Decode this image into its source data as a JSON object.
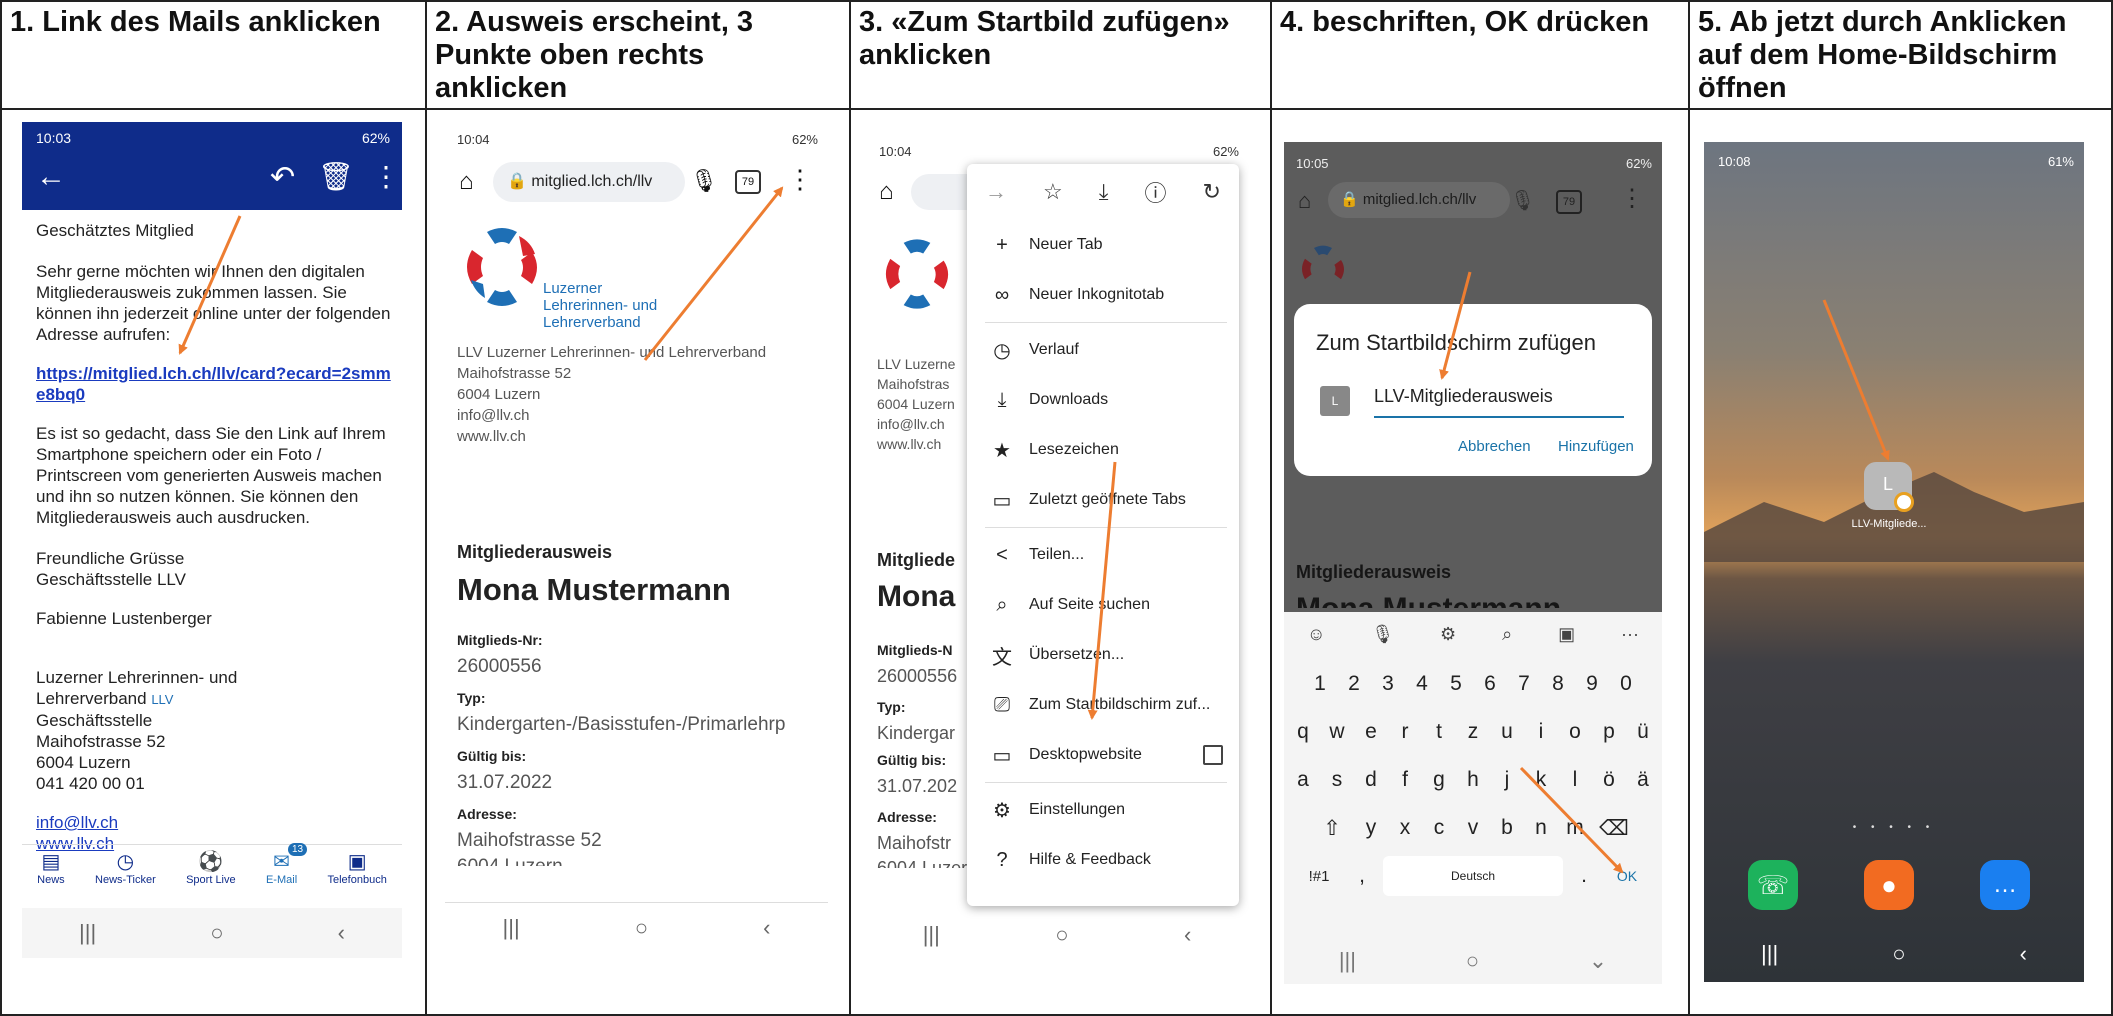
{
  "columns": [
    {
      "heading": "1. Link des Mails anklicken"
    },
    {
      "heading": "2. Ausweis erscheint, 3 Punkte oben rechts anklicken"
    },
    {
      "heading": "3. «Zum Startbild zufügen» anklicken"
    },
    {
      "heading": "4. beschriften, OK drücken"
    },
    {
      "heading": "5. Ab jetzt durch Anklicken auf dem Home-Bildschirm öffnen"
    }
  ],
  "screen1": {
    "time": "10:03",
    "status": "62%",
    "greeting": "Geschätztes Mitglied",
    "para1": "Sehr gerne möchten wir Ihnen den digitalen Mitgliederausweis zukommen lassen. Sie können ihn jederzeit online unter der folgenden Adresse aufrufen:",
    "link": "https://mitglied.lch.ch/llv/card?ecard=2smme8bq0",
    "para2": "Es ist so gedacht, dass Sie den Link auf Ihrem Smartphone speichern oder ein Foto / Printscreen vom generierten Ausweis machen und ihn so nutzen können. Sie können den Mitgliederausweis auch ausdrucken.",
    "closing1": "Freundliche Grüsse",
    "closing2": "Geschäftsstelle LLV",
    "signer": "Fabienne Lustenberger",
    "org1": "Luzerner Lehrerinnen- und",
    "org2": "Lehrerverband",
    "org2_badge": "LLV",
    "org3": "Geschäftsstelle",
    "org4": "Maihofstrasse 52",
    "org5": "6004 Luzern",
    "org6": "041 420 00 01",
    "mail": "info@llv.ch",
    "web": "www.llv.ch",
    "tabs": [
      "News",
      "News-Ticker",
      "Sport Live",
      "E-Mail",
      "Telefonbuch"
    ],
    "mail_badge": "13"
  },
  "screen2": {
    "time": "10:04",
    "status": "62%",
    "url": "mitglied.lch.ch/llv",
    "tab_count": "79",
    "logo1": "Luzerner",
    "logo2": "Lehrerinnen- und",
    "logo3": "Lehrerverband",
    "addr1": "LLV Luzerner Lehrerinnen- und Lehrerverband",
    "addr2": "Maihofstrasse 52",
    "addr3": "6004 Luzern",
    "addr4": "info@llv.ch",
    "addr5": "www.llv.ch",
    "card_title": "Mitgliederausweis",
    "name": "Mona Mustermann",
    "lbl_nr": "Mitglieds-Nr:",
    "nr": "26000556",
    "lbl_typ": "Typ:",
    "typ": "Kindergarten-/Basisstufen-/Primarlehrp",
    "lbl_valid": "Gültig bis:",
    "valid": "31.07.2022",
    "lbl_addr": "Adresse:",
    "addr": "Maihofstrasse 52",
    "addr_cut": "6004 Luzern"
  },
  "screen3": {
    "time": "10:04",
    "status": "62%",
    "bg_lines": [
      "LLV Luzerne",
      "Maihofstras",
      "6004 Luzern",
      "info@llv.ch",
      "www.llv.ch"
    ],
    "bg_title": "Mitgliede",
    "bg_name": "Mona",
    "bg_lbl_nr": "Mitglieds-N",
    "bg_nr": "26000556",
    "bg_lbl_typ": "Typ:",
    "bg_typ": "Kindergar",
    "bg_lbl_valid": "Gültig bis:",
    "bg_valid": "31.07.202",
    "bg_lbl_addr": "Adresse:",
    "bg_addr": "Maihofstr",
    "bg_cut": "6004 Luzern",
    "menu": [
      {
        "icon": "+",
        "label": "Neuer Tab",
        "name": "new-tab"
      },
      {
        "icon": "∞",
        "label": "Neuer Inkognitotab",
        "name": "incognito-tab"
      },
      {
        "icon": "◷",
        "label": "Verlauf",
        "name": "history"
      },
      {
        "icon": "⤓",
        "label": "Downloads",
        "name": "downloads"
      },
      {
        "icon": "★",
        "label": "Lesezeichen",
        "name": "bookmarks"
      },
      {
        "icon": "▭",
        "label": "Zuletzt geöffnete Tabs",
        "name": "recent-tabs"
      },
      {
        "icon": "<",
        "label": "Teilen...",
        "name": "share"
      },
      {
        "icon": "⌕",
        "label": "Auf Seite suchen",
        "name": "find-in-page"
      },
      {
        "icon": "文",
        "label": "Übersetzen...",
        "name": "translate"
      },
      {
        "icon": "⎚",
        "label": "Zum Startbildschirm zuf...",
        "name": "add-to-home"
      },
      {
        "icon": "▭",
        "label": "Desktopwebsite",
        "name": "desktop-site"
      },
      {
        "icon": "⚙",
        "label": "Einstellungen",
        "name": "settings"
      },
      {
        "icon": "?",
        "label": "Hilfe & Feedback",
        "name": "help-feedback"
      }
    ]
  },
  "screen4": {
    "time": "10:05",
    "status": "62%",
    "url": "mitglied.lch.ch/llv",
    "tab_count": "79",
    "dialog_title": "Zum Startbildschirm zufügen",
    "icon_letter": "L",
    "input_value": "LLV-Mitgliederausweis",
    "cancel": "Abbrechen",
    "add": "Hinzufügen",
    "bg_title": "Mitgliederausweis",
    "bg_name": "Mona Mustermann",
    "row1": [
      "1",
      "2",
      "3",
      "4",
      "5",
      "6",
      "7",
      "8",
      "9",
      "0"
    ],
    "row2": [
      "q",
      "w",
      "e",
      "r",
      "t",
      "z",
      "u",
      "i",
      "o",
      "p",
      "ü"
    ],
    "row3": [
      "a",
      "s",
      "d",
      "f",
      "g",
      "h",
      "j",
      "k",
      "l",
      "ö",
      "ä"
    ],
    "row4": [
      "y",
      "x",
      "c",
      "v",
      "b",
      "n",
      "m"
    ],
    "sym": "!#1",
    "comma": ",",
    "space": "Deutsch",
    "dot": ".",
    "ok": "OK"
  },
  "screen5": {
    "time": "10:08",
    "status": "61%",
    "app_letter": "L",
    "app_label": "LLV-Mitgliede..."
  },
  "colors": {
    "arrow": "#ed7d31",
    "mail_header": "#0f2c8a",
    "link": "#1a3bbf",
    "logo_red": "#d9262e",
    "logo_blue": "#1e6fb5",
    "teal": "#1a73a8"
  }
}
